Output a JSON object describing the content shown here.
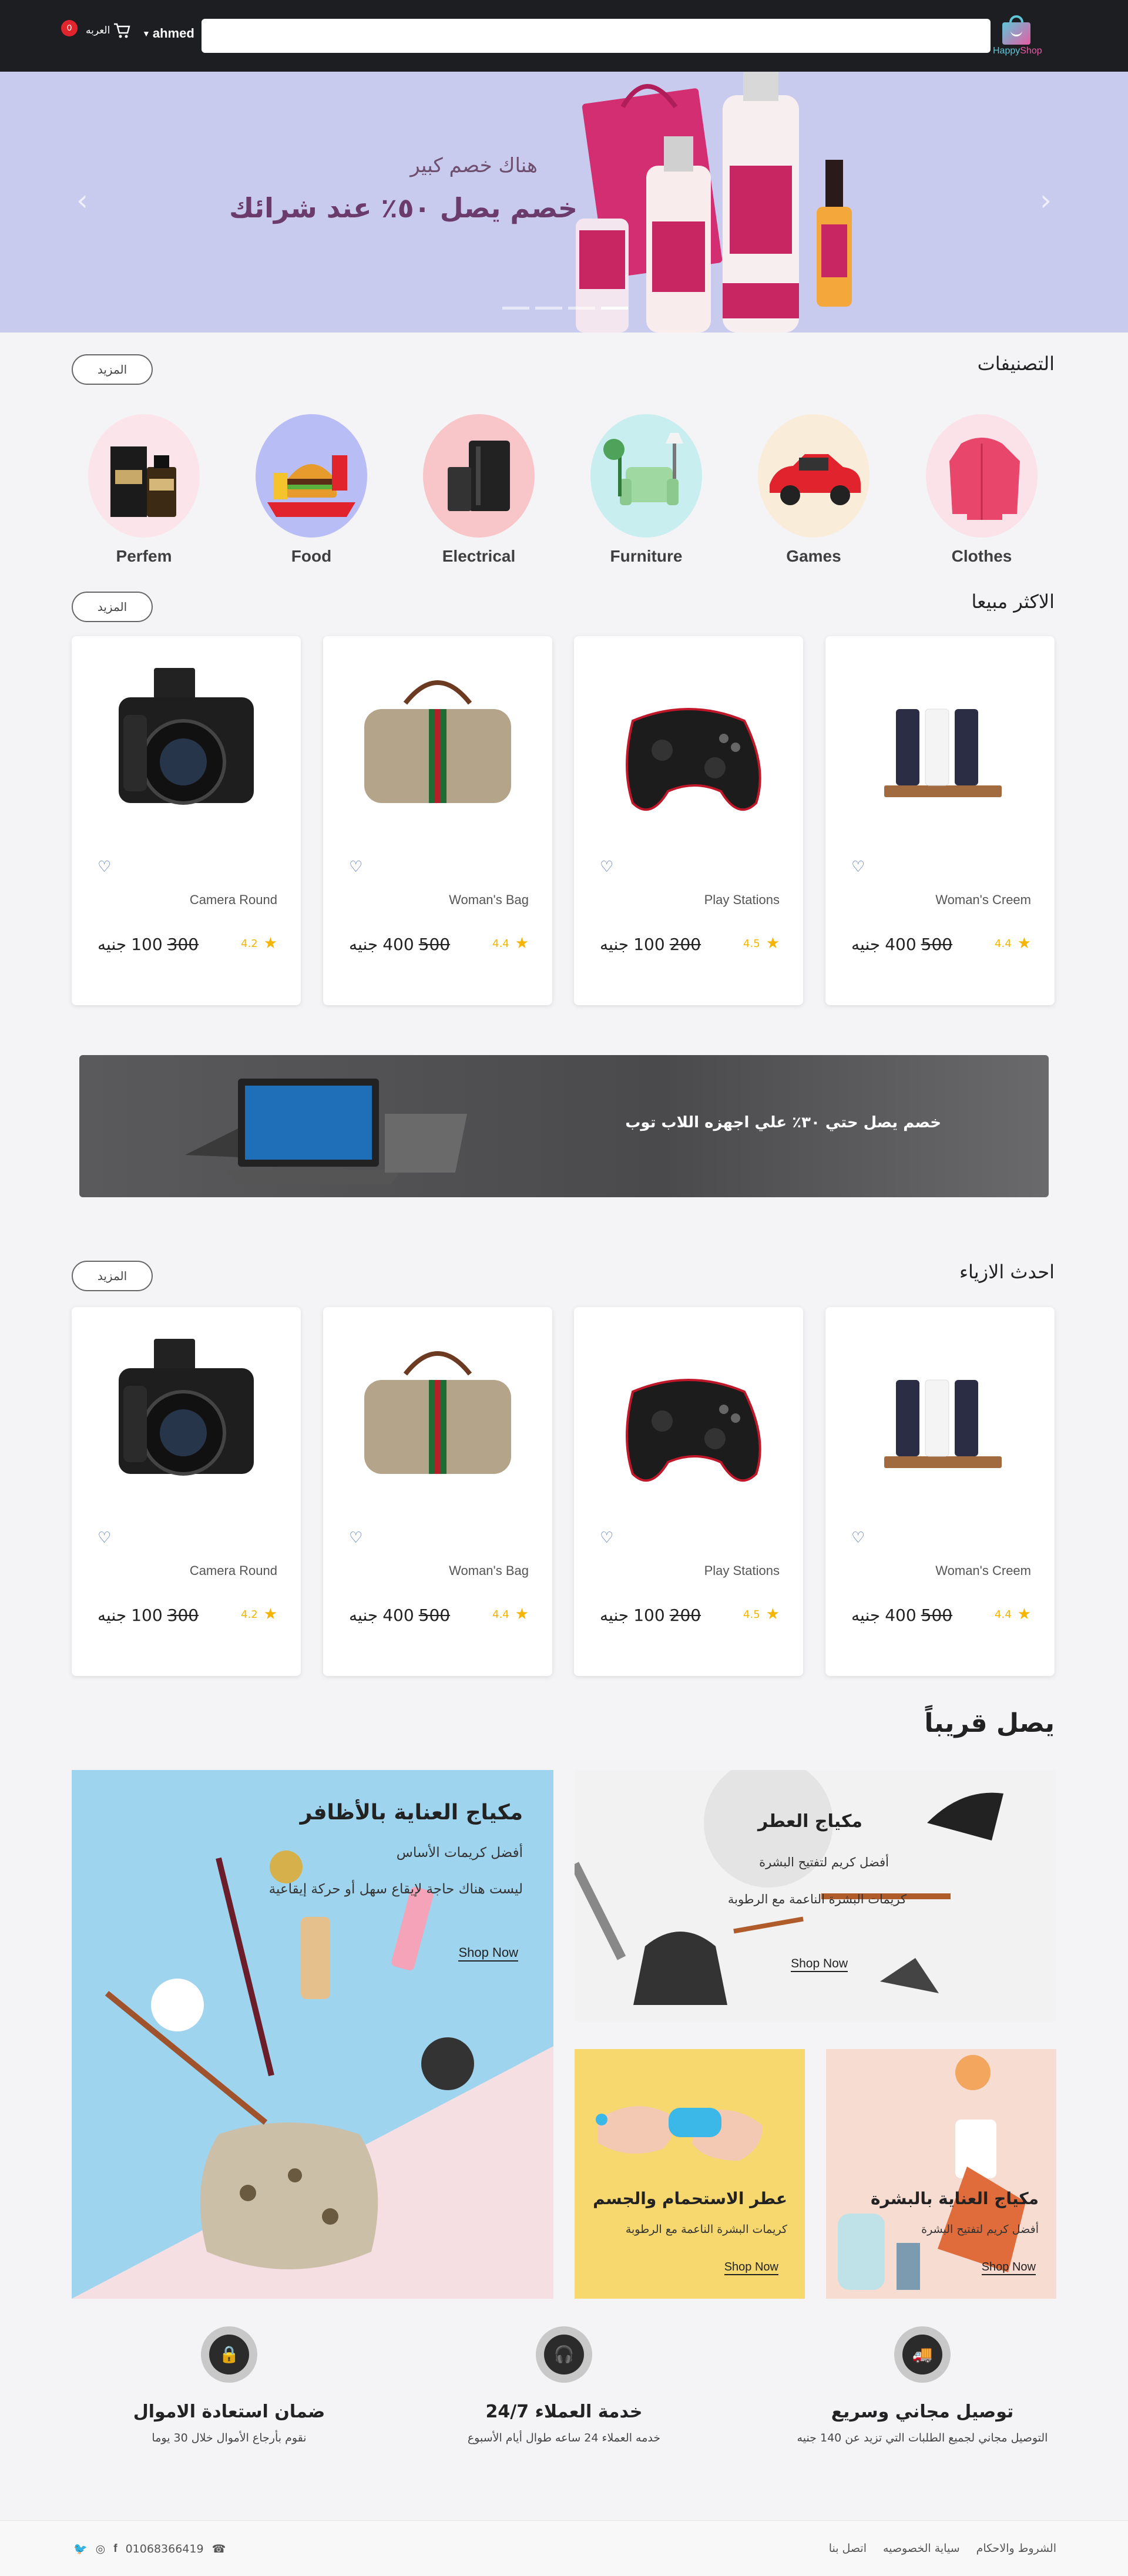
{
  "header": {
    "logo": {
      "word1": "Happy",
      "word2": "Shop"
    },
    "search": {
      "placeholder": ""
    },
    "user": {
      "name": "ahmed"
    },
    "cart": {
      "label": "العربه",
      "count": "0"
    }
  },
  "hero": {
    "subtitle": "هناك خصم كبير",
    "headline": "خصم يصل ٥٠٪ عند شرائك",
    "slide_count": 4,
    "active_slide": 3
  },
  "categories": {
    "title": "التصنيفات",
    "more": "المزيد",
    "items": [
      {
        "name": "Clothes",
        "bg": "#fbe1e8"
      },
      {
        "name": "Games",
        "bg": "#f9ecd9"
      },
      {
        "name": "Furniture",
        "bg": "#c9eef0"
      },
      {
        "name": "Electrical",
        "bg": "#f8c6c8"
      },
      {
        "name": "Food",
        "bg": "#b8bdf5"
      },
      {
        "name": "Perfem",
        "bg": "#fbe5ea"
      }
    ]
  },
  "best_sellers": {
    "title": "الاكثر مبيعا",
    "more": "المزيد",
    "products": [
      {
        "name": "Woman's Creem",
        "rating": "4.4",
        "price": "400",
        "old_price": "500",
        "currency": "جنيه"
      },
      {
        "name": "Play Stations",
        "rating": "4.5",
        "price": "100",
        "old_price": "200",
        "currency": "جنيه"
      },
      {
        "name": "Woman's Bag",
        "rating": "4.4",
        "price": "400",
        "old_price": "500",
        "currency": "جنيه"
      },
      {
        "name": "Camera Round",
        "rating": "4.2",
        "price": "100",
        "old_price": "300",
        "currency": "جنيه"
      }
    ]
  },
  "promo": {
    "text": "خصم يصل حتي ٣٠٪ علي اجهزه اللاب توب"
  },
  "new_fashion": {
    "title": "احدث الازياء",
    "more": "المزيد",
    "products": [
      {
        "name": "Woman's Creem",
        "rating": "4.4",
        "price": "400",
        "old_price": "500",
        "currency": "جنيه"
      },
      {
        "name": "Play Stations",
        "rating": "4.5",
        "price": "100",
        "old_price": "200",
        "currency": "جنيه"
      },
      {
        "name": "Woman's Bag",
        "rating": "4.4",
        "price": "400",
        "old_price": "500",
        "currency": "جنيه"
      },
      {
        "name": "Camera Round",
        "rating": "4.2",
        "price": "100",
        "old_price": "300",
        "currency": "جنيه"
      }
    ]
  },
  "coming_soon": {
    "title": "يصل قريباً",
    "big": {
      "title": "مكياج العناية بالأظافر",
      "line1": "أفضل كريمات الأساس",
      "line2": "ليست هناك حاجة لإيقاع سهل أو حركة إيقاعية",
      "link": "Shop Now"
    },
    "perfume": {
      "title": "مكياج العطر",
      "line1": "أفضل كريم لتفتيح البشرة",
      "line2": "كريمات البشرة الناعمة مع الرطوبة",
      "link": "Shop Now"
    },
    "bath": {
      "title": "عطر الاستحمام والجسم",
      "line1": "كريمات البشرة الناعمة مع الرطوبة",
      "link": "Shop Now"
    },
    "skin": {
      "title": "مكياج العناية بالبشرة",
      "line1": "أفضل كريم لتفتيح البشرة",
      "link": "Shop Now"
    }
  },
  "features": [
    {
      "title": "توصيل مجاني وسريع",
      "desc": "التوصيل مجاني لجميع الطلبات التي تزيد عن 140 جنيه",
      "icon": "truck-icon"
    },
    {
      "title": "خدمة العملاء 24/7",
      "desc": "خدمه العملاء 24 ساعه طوال أيام الأسبوع",
      "icon": "headset-icon"
    },
    {
      "title": "ضمان استعادة الاموال",
      "desc": "نقوم بأرجاع الأموال خلال 30 يوما",
      "icon": "lock-icon"
    }
  ],
  "footer": {
    "links": [
      "الشروط والاحكام",
      "سياية الخصوصيه",
      "اتصل بنا"
    ],
    "phone": "01068366419"
  }
}
